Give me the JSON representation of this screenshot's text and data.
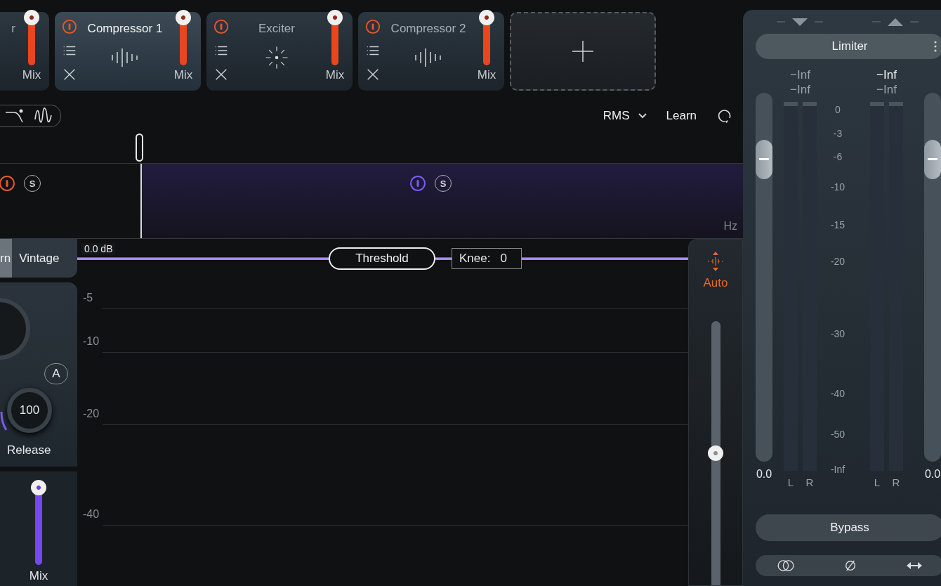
{
  "modules": [
    {
      "name": "r",
      "kind": "cut",
      "selected": false,
      "mix_label": "Mix",
      "level": 1
    },
    {
      "name": "Compressor 1",
      "kind": "compressor",
      "selected": true,
      "mix_label": "Mix",
      "level": 1
    },
    {
      "name": "Exciter",
      "kind": "exciter",
      "selected": false,
      "mix_label": "Mix",
      "level": 1
    },
    {
      "name": "Compressor 2",
      "kind": "compressor",
      "selected": false,
      "mix_label": "Mix",
      "level": 1
    }
  ],
  "toolbar": {
    "detection": "RMS",
    "learn": "Learn"
  },
  "bands": [
    {
      "selected": false,
      "on": true,
      "color": "#e8572a",
      "solo": "S"
    },
    {
      "selected": true,
      "on": true,
      "color": "#7b5cf0",
      "solo": "S",
      "unit": "Hz"
    }
  ],
  "modes": [
    {
      "label": "rn",
      "selected": true
    },
    {
      "label": "Vintage",
      "selected": false
    }
  ],
  "release": {
    "label": "Release",
    "value": "100",
    "auto": "A"
  },
  "mix": {
    "label": "Mix",
    "level": 1
  },
  "graph": {
    "threshold_value": "0.0 dB",
    "threshold": "Threshold",
    "knee_label": "Knee:",
    "knee_value": "0",
    "gridlines": [
      "-5",
      "-10",
      "-20",
      "-40"
    ]
  },
  "auto": {
    "label": "Auto",
    "on": true,
    "level": 0.5
  },
  "limiter": {
    "title": "Limiter",
    "bypass": "Bypass",
    "meters": [
      {
        "peak": "−Inf",
        "rms": "−Inf",
        "gain": "0.0",
        "level": 0.82,
        "channels": [
          "L",
          "R"
        ],
        "bright": false
      },
      {
        "peak": "−Inf",
        "rms": "−Inf",
        "gain": "0.0",
        "level": 0.82,
        "channels": [
          "L",
          "R"
        ],
        "bright": true
      }
    ],
    "scale": [
      "0",
      "-3",
      "-6",
      "-10",
      "-15",
      "-20",
      "-30",
      "-40",
      "-50",
      "-Inf"
    ]
  }
}
